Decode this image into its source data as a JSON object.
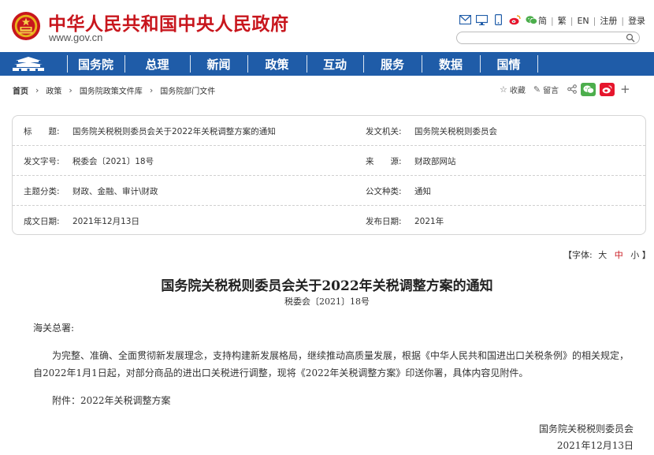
{
  "header": {
    "site_name": "中华人民共和国中央人民政府",
    "domain": "www.gov.cn",
    "top_links": [
      "简",
      "繁",
      "EN",
      "注册",
      "登录"
    ],
    "search_placeholder": ""
  },
  "nav": {
    "items": [
      "国务院",
      "总理",
      "新闻",
      "政策",
      "互动",
      "服务",
      "数据",
      "国情"
    ]
  },
  "breadcrumb": [
    "首页",
    "政策",
    "国务院政策文件库",
    "国务院部门文件"
  ],
  "tools": {
    "favorite": "收藏",
    "comment": "留言",
    "plus": "+"
  },
  "info": {
    "title_label": "标　　题:",
    "title_value": "国务院关税税则委员会关于2022年关税调整方案的通知",
    "issuer_label": "发文机关:",
    "issuer_value": "国务院关税税则委员会",
    "docno_label": "发文字号:",
    "docno_value": "税委会〔2021〕18号",
    "source_label": "来　　源:",
    "source_value": "财政部网站",
    "topic_label": "主题分类:",
    "topic_value": "财政、金融、审计\\财政",
    "doctype_label": "公文种类:",
    "doctype_value": "通知",
    "written_label": "成文日期:",
    "written_value": "2021年12月13日",
    "published_label": "发布日期:",
    "published_value": "2021年"
  },
  "fontsize": {
    "open": "【字体:",
    "large": "大",
    "medium": "中",
    "small": "小",
    "close": "】"
  },
  "article": {
    "title": "国务院关税税则委员会关于2022年关税调整方案的通知",
    "doc_number": "税委会〔2021〕18号",
    "salutation": "海关总署:",
    "paragraph1": "为完整、准确、全面贯彻新发展理念，支持构建新发展格局，继续推动高质量发展，根据《中华人民共和国进出口关税条例》的相关规定，自2022年1月1日起，对部分商品的进出口关税进行调整，现将《2022年关税调整方案》印送你署，具体内容见附件。",
    "attachment": "附件：2022年关税调整方案",
    "signature": "国务院关税税则委员会",
    "date": "2021年12月13日"
  },
  "colors": {
    "brand_red": "#c8161d",
    "nav_blue": "#1f5ca8",
    "wechat_green": "#4cae4c",
    "weibo_red": "#e6162d"
  }
}
